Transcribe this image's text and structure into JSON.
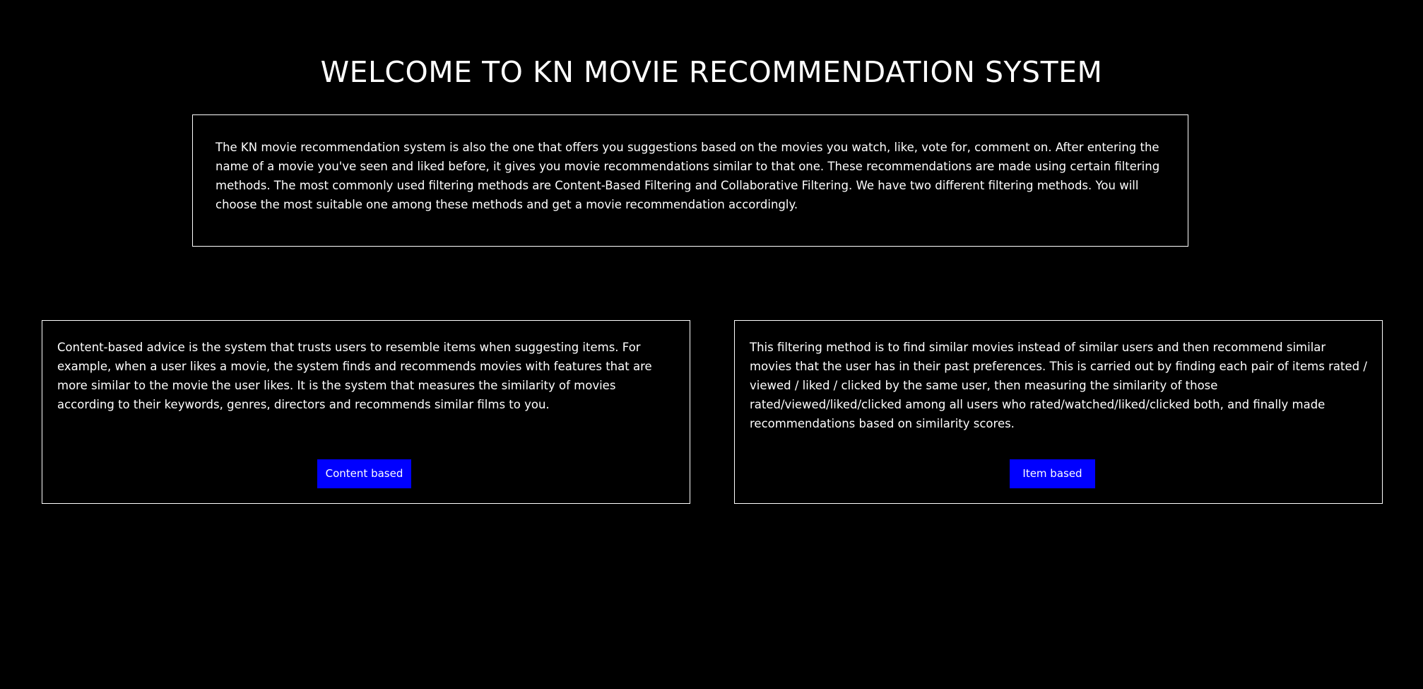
{
  "header": {
    "title": "WELCOME TO KN MOVIE RECOMMENDATION SYSTEM"
  },
  "intro": {
    "text": "The KN movie recommendation system is also the one that offers you suggestions based on the movies you watch, like, vote for, comment on. After entering the name of a movie you've seen and liked before, it gives you movie recommendations similar to that one. These recommendations are made using certain filtering methods. The most commonly used filtering methods are Content-Based Filtering and Collaborative Filtering. We have two different filtering methods. You will choose the most suitable one among these methods and get a movie recommendation accordingly."
  },
  "content_based": {
    "description": "Content-based advice is the system that trusts users to resemble items when suggesting items. For example, when a user likes a movie, the system finds and recommends movies with features that are more similar to the movie the user likes. It is the system that measures the similarity of movies according to their keywords, genres, directors and recommends similar films to you.",
    "button_label": "Content based"
  },
  "item_based": {
    "description": "This filtering method is to find similar movies instead of similar users and then recommend similar movies that the user has in their past preferences. This is carried out by finding each pair of items rated / viewed / liked / clicked by the same user, then measuring the similarity of those rated/viewed/liked/clicked among all users who rated/watched/liked/clicked both, and finally made recommendations based on similarity scores.",
    "button_label": "Item based"
  },
  "colors": {
    "background": "#000000",
    "text": "#ffffff",
    "border": "#ffffff",
    "button": "#0000ff"
  }
}
